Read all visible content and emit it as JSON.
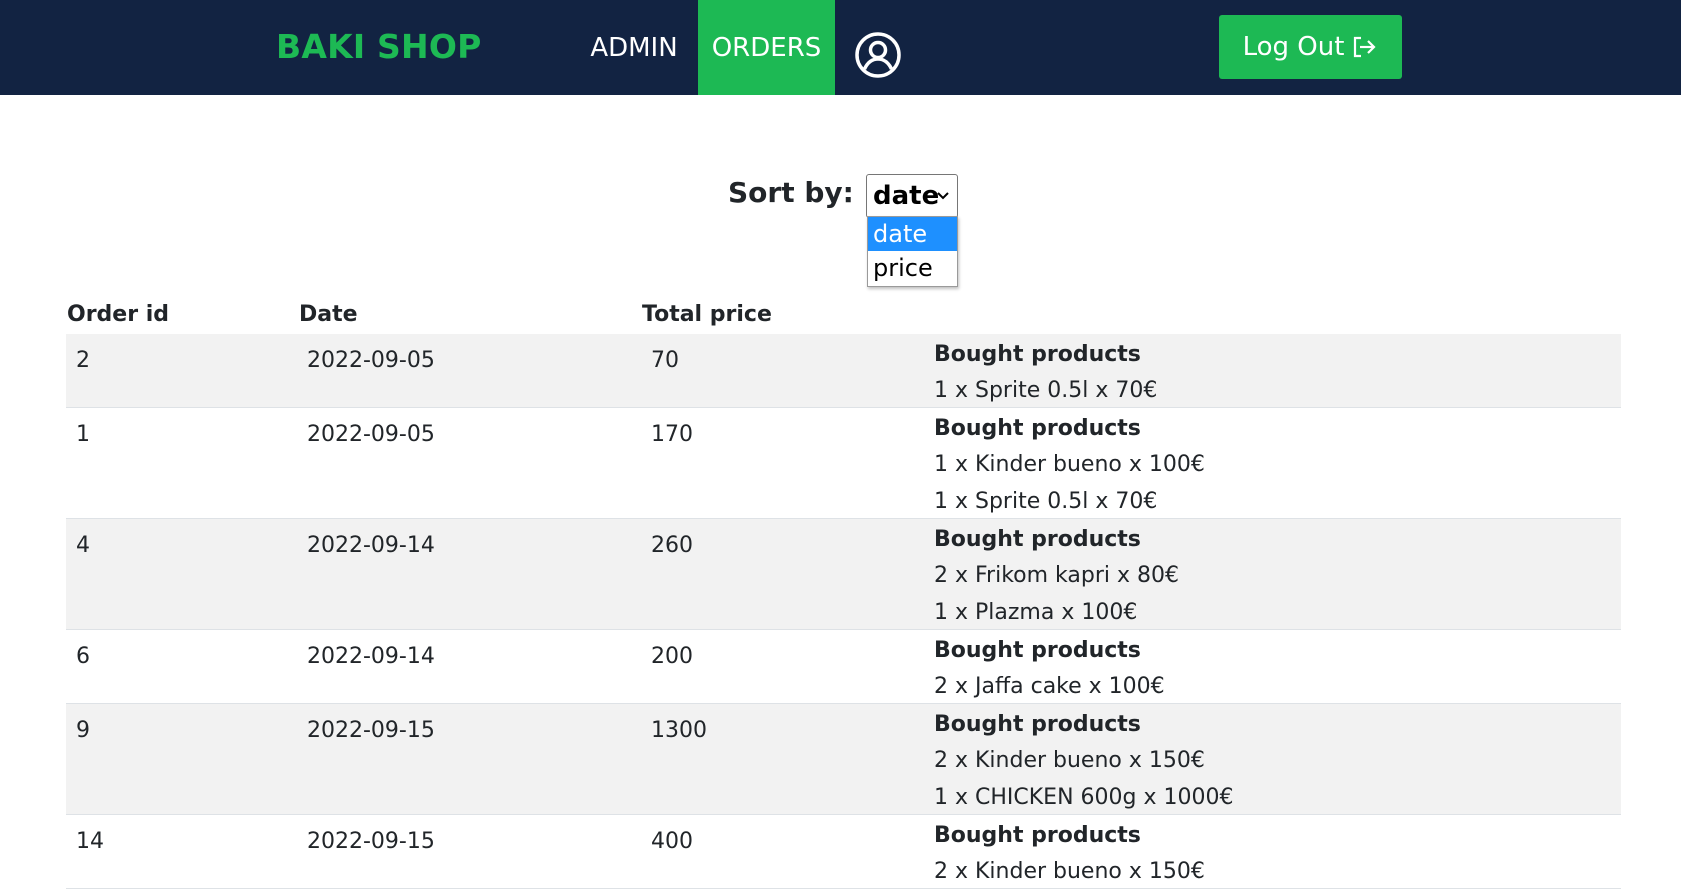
{
  "navbar": {
    "brand": "BAKI SHOP",
    "links": [
      {
        "label": "ADMIN",
        "active": false
      },
      {
        "label": "ORDERS",
        "active": true
      }
    ],
    "profile_icon": "user-circle-icon",
    "logout_label": "Log Out",
    "logout_icon": "logout-arrow-icon",
    "colors": {
      "background": "#122342",
      "accent": "#1db954"
    }
  },
  "sort": {
    "label": "Sort by:",
    "selected": "date",
    "options": [
      "date",
      "price"
    ],
    "highlighted_option": "date"
  },
  "table": {
    "headers": [
      "Order id",
      "Date",
      "Total price"
    ],
    "products_heading": "Bought products",
    "rows": [
      {
        "id": "2",
        "date": "2022-09-05",
        "total": "70",
        "products": [
          "1 x Sprite 0.5l x 70€"
        ]
      },
      {
        "id": "1",
        "date": "2022-09-05",
        "total": "170",
        "products": [
          "1 x Kinder bueno x 100€",
          "1 x Sprite 0.5l x 70€"
        ]
      },
      {
        "id": "4",
        "date": "2022-09-14",
        "total": "260",
        "products": [
          "2 x Frikom kapri x 80€",
          "1 x Plazma x 100€"
        ]
      },
      {
        "id": "6",
        "date": "2022-09-14",
        "total": "200",
        "products": [
          "2 x Jaffa cake x 100€"
        ]
      },
      {
        "id": "9",
        "date": "2022-09-15",
        "total": "1300",
        "products": [
          "2 x Kinder bueno x 150€",
          "1 x CHICKEN 600g x 1000€"
        ]
      },
      {
        "id": "14",
        "date": "2022-09-15",
        "total": "400",
        "products": [
          "2 x Kinder bueno x 150€"
        ]
      }
    ]
  }
}
